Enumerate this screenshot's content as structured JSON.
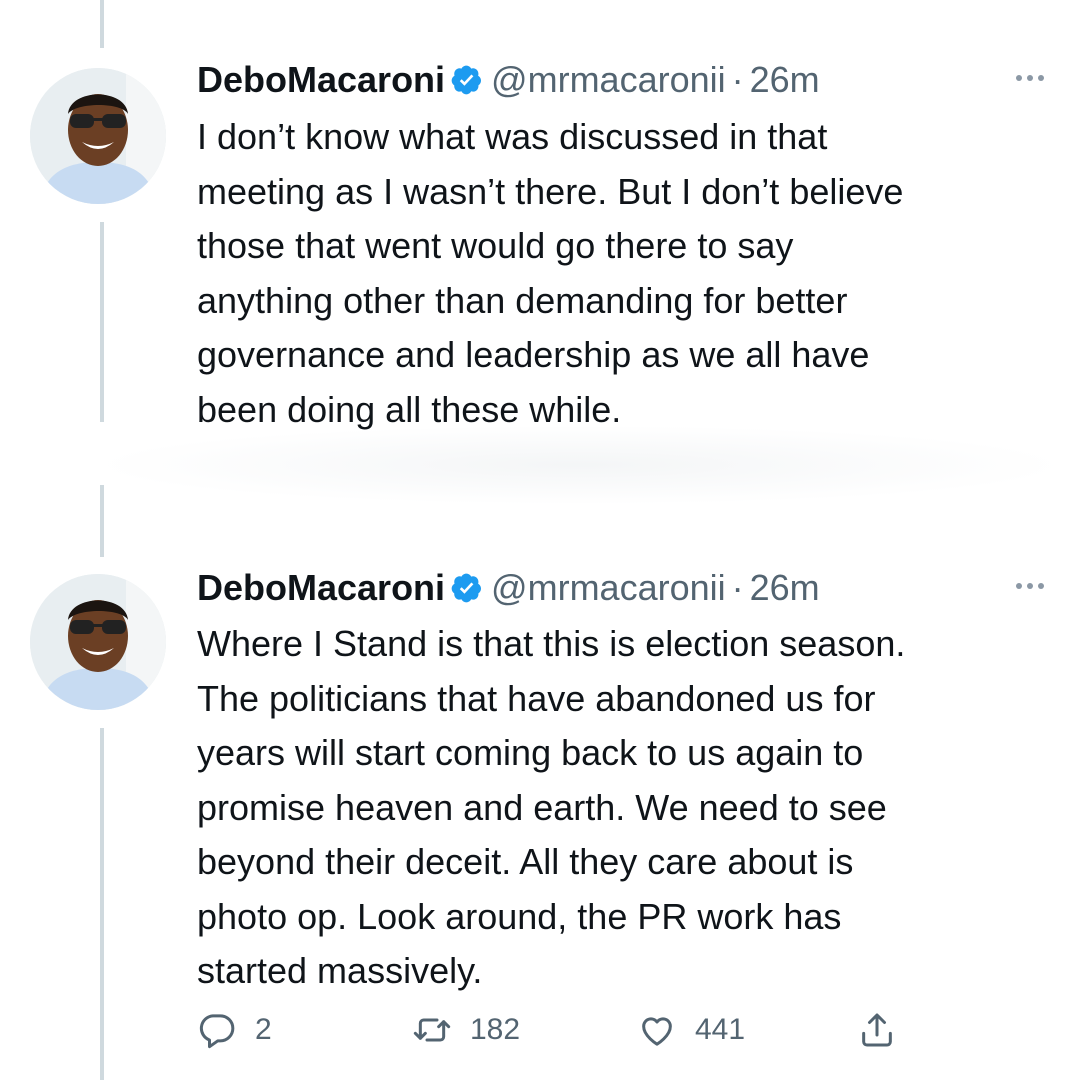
{
  "tweets": [
    {
      "display_name": "DeboMacaroni",
      "handle": "@mrmacaronii",
      "separator": "·",
      "time": "26m",
      "lines": [
        "I don’t know what was discussed in that",
        "meeting as I wasn’t there. But I don’t believe",
        "those that went would go there to say",
        "anything other than demanding for better",
        "governance and leadership as we all have",
        "been doing all these while."
      ]
    },
    {
      "display_name": "DeboMacaroni",
      "handle": "@mrmacaronii",
      "separator": "·",
      "time": "26m",
      "lines": [
        "Where I Stand is that this is election season.",
        "The politicians that have abandoned us for",
        "years will start coming back to us again to",
        "promise heaven and earth. We need to see",
        "beyond their deceit. All they care about is",
        "photo op. Look around, the PR work has",
        "started massively."
      ],
      "actions": {
        "replies": "2",
        "retweets": "182",
        "likes": "441"
      }
    }
  ],
  "icons": {
    "verified": "verified-badge-icon",
    "more": "more-dots-icon",
    "reply": "reply-icon",
    "retweet": "retweet-icon",
    "like": "heart-icon",
    "share": "share-icon"
  },
  "colors": {
    "text": "#0f1419",
    "secondary": "#536471",
    "verified": "#1d9bf0",
    "thread_line": "#cfd9de"
  }
}
